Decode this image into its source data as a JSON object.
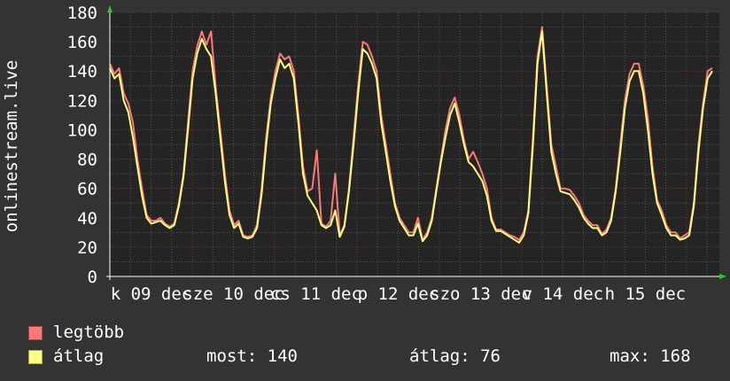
{
  "chart_data": {
    "type": "line",
    "ylabel": "onlinestream.live",
    "ylim": [
      0,
      180
    ],
    "yticks": [
      "0",
      "20",
      "40",
      "60",
      "80",
      "100",
      "120",
      "140",
      "160",
      "180"
    ],
    "xticks": [
      "k 09 dec",
      "sze 10 dec",
      "cs 11 dec",
      "p 12 dec",
      "szo 13 dec",
      "v 14 dec",
      "h 15 dec"
    ],
    "grid": true,
    "series": [
      {
        "name": "legtöbb",
        "color": "#ff7777",
        "values": [
          145,
          138,
          142,
          125,
          118,
          105,
          80,
          60,
          42,
          38,
          38,
          40,
          36,
          34,
          36,
          50,
          70,
          105,
          140,
          157,
          167,
          158,
          167,
          130,
          100,
          70,
          45,
          35,
          38,
          28,
          27,
          28,
          35,
          60,
          95,
          122,
          140,
          152,
          148,
          150,
          140,
          110,
          75,
          58,
          60,
          86,
          36,
          34,
          38,
          70,
          28,
          35,
          60,
          95,
          130,
          160,
          158,
          150,
          140,
          110,
          90,
          70,
          50,
          40,
          35,
          30,
          30,
          40,
          25,
          30,
          40,
          60,
          80,
          100,
          115,
          122,
          110,
          93,
          80,
          85,
          78,
          70,
          60,
          40,
          32,
          32,
          30,
          28,
          27,
          25,
          30,
          45,
          95,
          150,
          170,
          130,
          90,
          75,
          60,
          60,
          59,
          55,
          50,
          42,
          38,
          35,
          35,
          29,
          32,
          40,
          60,
          90,
          120,
          138,
          145,
          145,
          130,
          108,
          75,
          52,
          45,
          35,
          30,
          30,
          26,
          28,
          30,
          50,
          90,
          118,
          140,
          142
        ]
      },
      {
        "name": "átlag",
        "color": "#ffff7f",
        "values": [
          142,
          135,
          138,
          120,
          112,
          95,
          75,
          55,
          40,
          36,
          37,
          38,
          35,
          33,
          35,
          48,
          68,
          100,
          135,
          152,
          162,
          155,
          150,
          125,
          95,
          65,
          42,
          33,
          36,
          27,
          26,
          27,
          33,
          56,
          90,
          118,
          135,
          148,
          142,
          145,
          135,
          105,
          70,
          55,
          50,
          45,
          35,
          33,
          35,
          45,
          27,
          34,
          58,
          90,
          125,
          155,
          152,
          145,
          135,
          105,
          85,
          65,
          48,
          38,
          33,
          28,
          28,
          36,
          24,
          28,
          38,
          58,
          78,
          95,
          110,
          118,
          105,
          90,
          78,
          75,
          70,
          65,
          55,
          38,
          31,
          31,
          29,
          27,
          25,
          23,
          28,
          43,
          90,
          145,
          167,
          125,
          85,
          70,
          58,
          57,
          56,
          52,
          47,
          40,
          36,
          33,
          33,
          28,
          30,
          38,
          58,
          85,
          115,
          133,
          140,
          140,
          125,
          100,
          70,
          50,
          42,
          33,
          28,
          28,
          25,
          26,
          28,
          48,
          85,
          115,
          135,
          140
        ]
      }
    ]
  },
  "legend": {
    "items": [
      {
        "label": "legtöbb",
        "color": "#ff7777"
      },
      {
        "label": "átlag",
        "color": "#ffff7f"
      }
    ]
  },
  "stats": {
    "most": "most: 140",
    "atlag": "átlag: 76",
    "max": "max: 168"
  }
}
